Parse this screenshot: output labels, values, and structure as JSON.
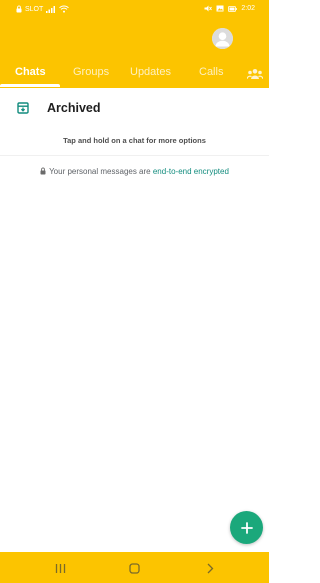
{
  "colors": {
    "header_bg": "#fcc400",
    "accent_green": "#1ba87b",
    "link_teal": "#128c7e"
  },
  "status_bar": {
    "left_icons": [
      "lock-icon",
      "wifi-icon",
      "signal-icon"
    ],
    "left_text": "SLOT",
    "right_text": "2:02",
    "right_icons": [
      "battery-icon"
    ]
  },
  "tabs": [
    {
      "label": "Chats",
      "active": true
    },
    {
      "label": "Groups",
      "active": false
    },
    {
      "label": "Updates",
      "active": false
    },
    {
      "label": "Calls",
      "active": false
    }
  ],
  "tab_extra_icon": "community-icon",
  "archived": {
    "label": "Archived",
    "icon": "archive-icon"
  },
  "hint": "Tap and hold on a chat for more options",
  "encryption": {
    "prefix": "Your personal messages are ",
    "link": "end-to-end encrypted"
  },
  "fab_icon": "plus-icon",
  "nav_bar": [
    "recent-apps-icon",
    "home-icon",
    "back-icon"
  ]
}
